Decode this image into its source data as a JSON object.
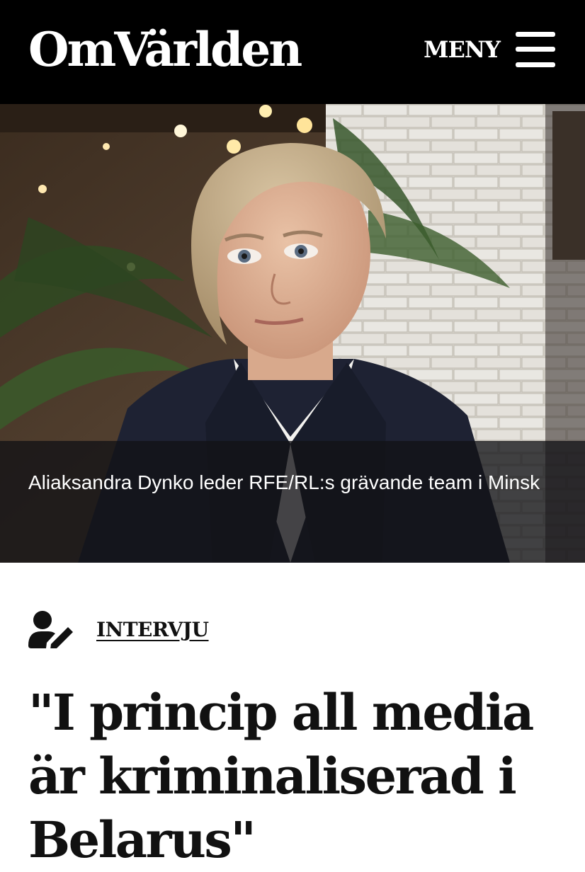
{
  "header": {
    "logo": "OmVärlden",
    "menu_label": "MENY",
    "menu_icon": "hamburger-icon",
    "background": "#000000"
  },
  "hero": {
    "caption": "Aliaksandra Dynko leder RFE/RL:s grävande team i Minsk"
  },
  "article": {
    "category": "INTERVJU",
    "category_icon": "user-edit-icon",
    "headline": "\"I princip all media är kriminaliserad i Belarus\""
  }
}
